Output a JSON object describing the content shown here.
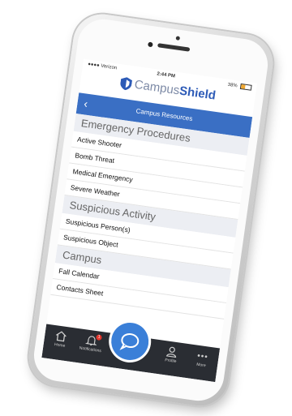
{
  "status_bar": {
    "carrier": "Verizon",
    "time": "2:44 PM",
    "battery": "38%",
    "battery_level": 0.38
  },
  "logo": {
    "brand_part1": "Campus",
    "brand_part2": "Shield"
  },
  "header": {
    "back_icon": "chevron-left-icon",
    "title": "Campus Resources"
  },
  "sections": [
    {
      "title": "Emergency Procedures",
      "items": [
        "Active Shooter",
        "Bomb Threat",
        "Medical Emergency",
        "Severe Weather"
      ]
    },
    {
      "title": "Suspicious Activity",
      "items": [
        "Suspicious Person(s)",
        "Suspicious Object"
      ]
    },
    {
      "title": "Campus",
      "items": [
        "Fall Calendar",
        "Contacts Sheet"
      ]
    }
  ],
  "tab_bar": {
    "home": "Home",
    "notifications": "Notifications",
    "notification_count": "1",
    "profile": "Profile",
    "more": "More"
  },
  "colors": {
    "accent": "#3a6fc4",
    "brand": "#2d5bb7",
    "tabbar": "#2a2d33",
    "badge": "#e5362c"
  }
}
